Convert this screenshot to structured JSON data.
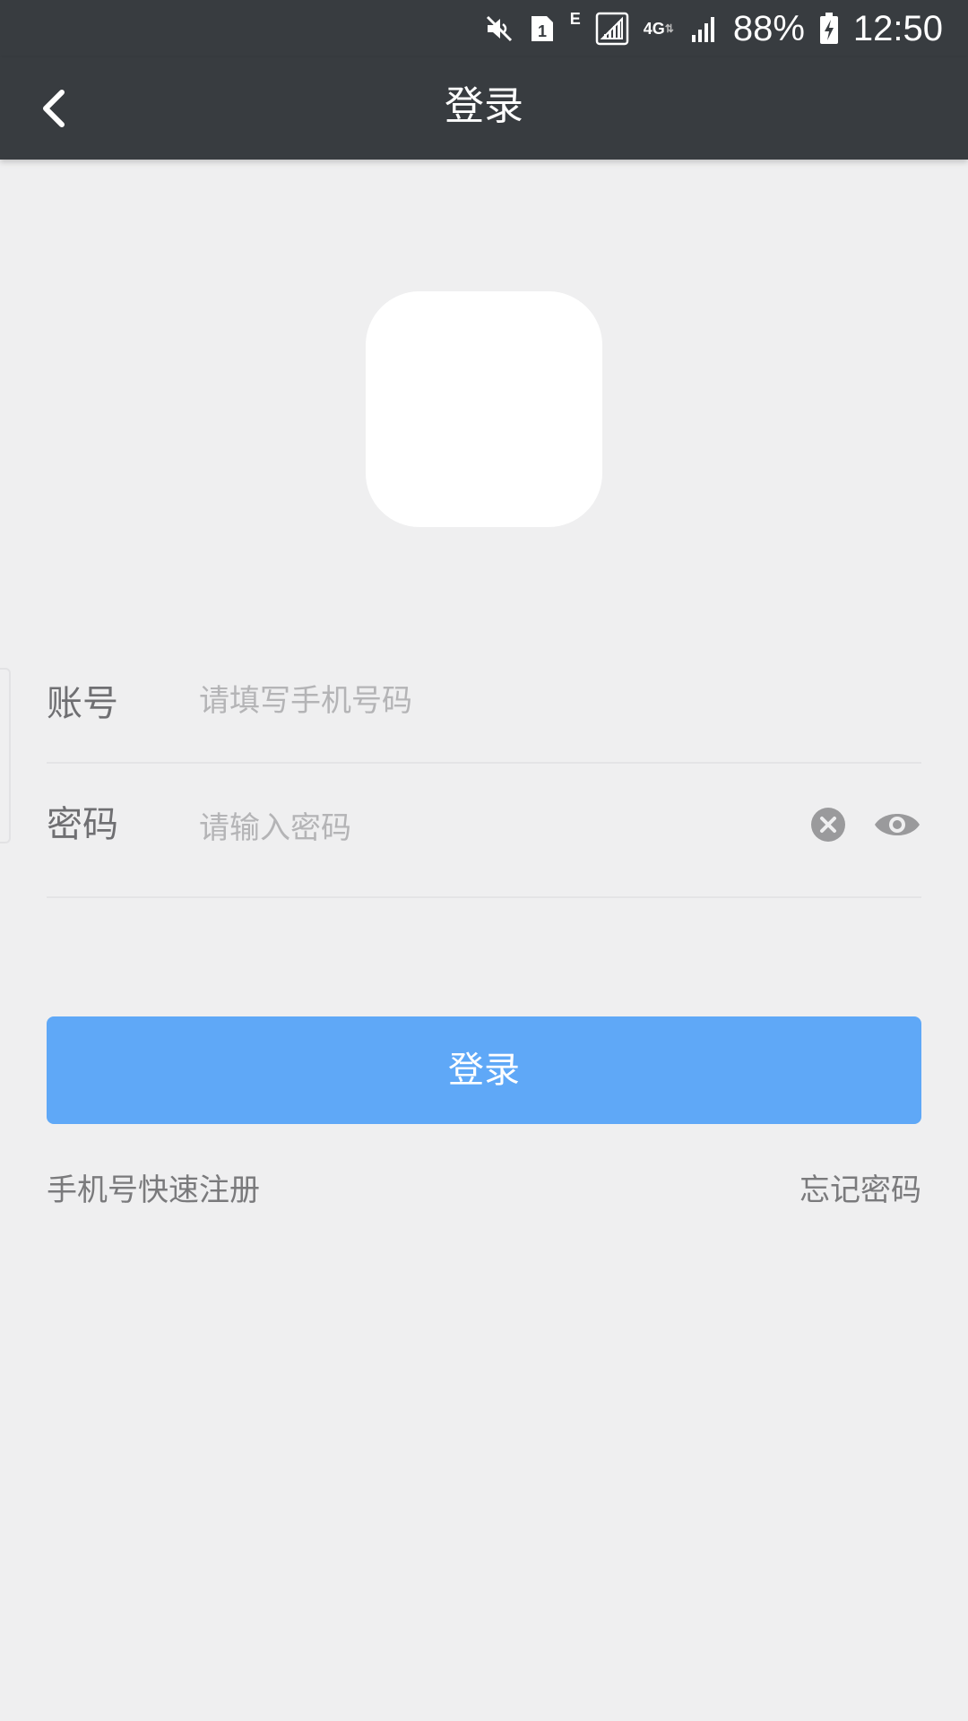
{
  "status_bar": {
    "network_type": "E",
    "network_4g": "4G",
    "battery_percent": "88%",
    "time": "12:50",
    "sim_slot": "1",
    "icons": [
      "mute-icon",
      "sim-icon",
      "signal-icon",
      "signal-icon",
      "battery-charging-icon"
    ]
  },
  "nav": {
    "title": "登录"
  },
  "form": {
    "account_label": "账号",
    "account_placeholder": "请填写手机号码",
    "password_label": "密码",
    "password_placeholder": "请输入密码"
  },
  "actions": {
    "login_label": "登录",
    "register_label": "手机号快速注册",
    "forgot_label": "忘记密码"
  },
  "colors": {
    "header_bg": "#383c40",
    "page_bg": "#efeff0",
    "primary": "#5fa8f7"
  }
}
